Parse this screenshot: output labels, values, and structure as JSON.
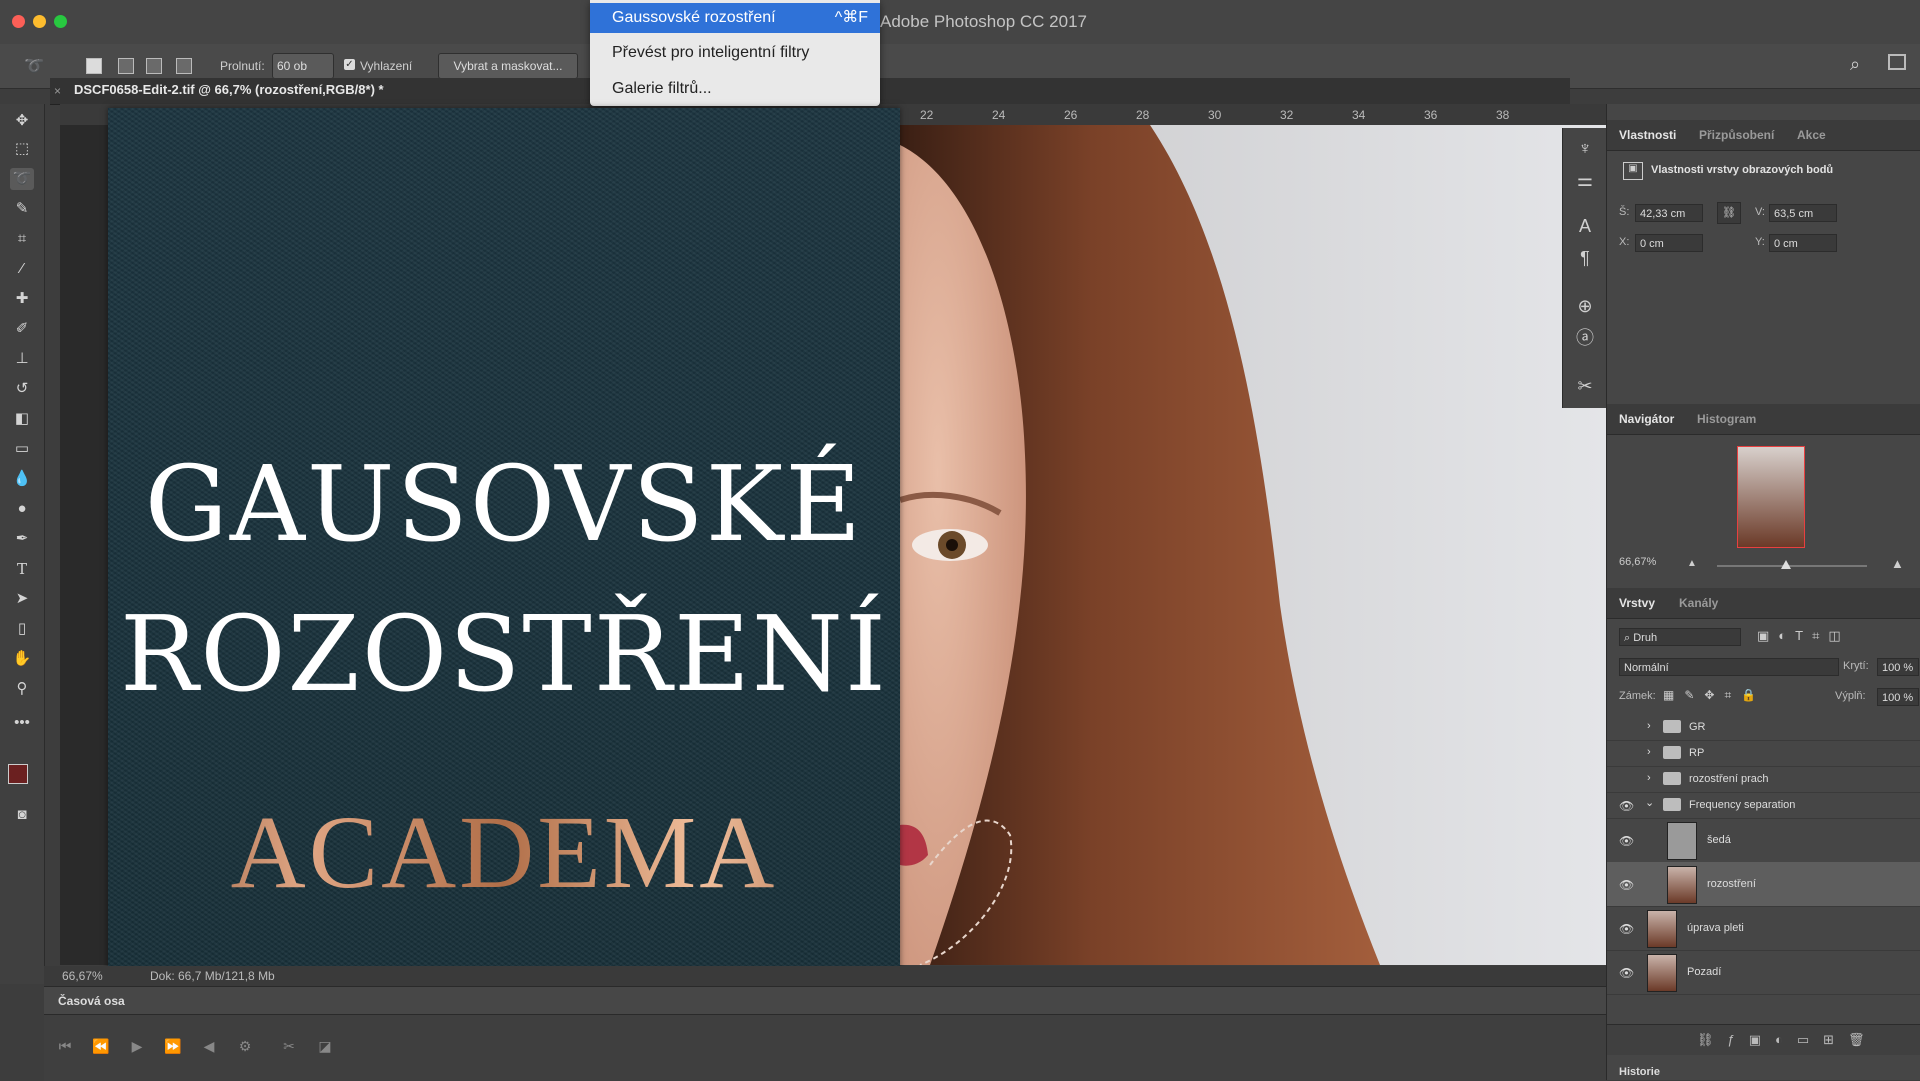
{
  "app": {
    "title": "Adobe Photoshop CC 2017"
  },
  "options_bar": {
    "feather_label": "Prolnutí:",
    "feather_value": "60 ob",
    "antialias_label": "Vyhlazení",
    "antialias_checked": true,
    "select_mask_label": "Vybrat a maskovat..."
  },
  "document": {
    "tab_label": "DSCF0658-Edit-2.tif @ 66,7% (rozostření,RGB/8*) *",
    "zoom": "66,67%",
    "doc_info": "Dok: 66,7 Mb/121,8 Mb"
  },
  "filter_menu": {
    "items": [
      {
        "label": "Gaussovské rozostření",
        "shortcut": "^⌘F",
        "selected": true
      },
      {
        "label": "Převést pro inteligentní filtry",
        "selected": false
      },
      {
        "label": "Galerie filtrů...",
        "selected": false
      }
    ]
  },
  "ruler": {
    "ticks": [
      "22",
      "24",
      "26",
      "28",
      "30",
      "32",
      "34",
      "36",
      "38"
    ]
  },
  "overlay": {
    "line1": "GAUSOVSKÉ",
    "line2": "ROZOSTŘENÍ",
    "brand": "ACADEMA"
  },
  "timeline": {
    "title": "Časová osa"
  },
  "properties": {
    "tabs": [
      "Vlastnosti",
      "Přizpůsobení",
      "Akce"
    ],
    "heading": "Vlastnosti vrstvy obrazových bodů",
    "w_label": "Š:",
    "w_value": "42,33 cm",
    "h_label": "V:",
    "h_value": "63,5 cm",
    "x_label": "X:",
    "x_value": "0 cm",
    "y_label": "Y:",
    "y_value": "0 cm"
  },
  "navigator": {
    "tabs": [
      "Navigátor",
      "Histogram"
    ],
    "zoom": "66,67%"
  },
  "layers": {
    "tabs": [
      "Vrstvy",
      "Kanály"
    ],
    "filter_placeholder": "Druh",
    "blend_mode": "Normální",
    "opacity_label": "Krytí:",
    "opacity_value": "100 %",
    "lock_label": "Zámek:",
    "fill_label": "Výplň:",
    "fill_value": "100 %",
    "items": [
      {
        "name": "GR",
        "type": "group",
        "visible": false
      },
      {
        "name": "RP",
        "type": "group",
        "visible": false
      },
      {
        "name": "rozostření prach",
        "type": "group",
        "visible": false
      },
      {
        "name": "Frequency separation",
        "type": "group-open",
        "visible": true
      },
      {
        "name": "šedá",
        "type": "layer",
        "visible": true
      },
      {
        "name": "rozostření",
        "type": "layer",
        "visible": true,
        "selected": true
      },
      {
        "name": "úprava pleti",
        "type": "layer",
        "visible": true
      },
      {
        "name": "Pozadí",
        "type": "layer",
        "visible": true
      }
    ]
  },
  "history": {
    "title": "Historie"
  }
}
